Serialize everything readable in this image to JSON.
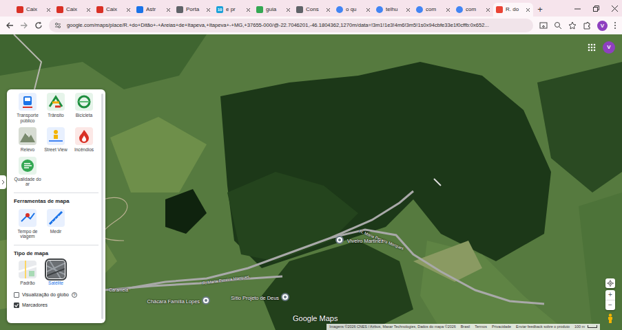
{
  "tabs": [
    {
      "label": "Caix",
      "selected": false
    },
    {
      "label": "Caix",
      "selected": false
    },
    {
      "label": "Caix",
      "selected": false
    },
    {
      "label": "Astr",
      "selected": false
    },
    {
      "label": "Porta",
      "selected": false
    },
    {
      "label": "e pr",
      "selected": false,
      "icon_text": "10"
    },
    {
      "label": "guia",
      "selected": false
    },
    {
      "label": "Cons",
      "selected": false
    },
    {
      "label": "o qu",
      "selected": false
    },
    {
      "label": "telhu",
      "selected": false
    },
    {
      "label": "com",
      "selected": false
    },
    {
      "label": "com",
      "selected": false
    },
    {
      "label": "R. do",
      "selected": true
    }
  ],
  "new_tab": "+",
  "address_bar": {
    "url": "google.com/maps/place/R.+do+Ditão+-+Areias+de+Itapeva,+Itapeva+-+MG,+37655-000/@-22.7046201,-46.1804362,1270m/data=!3m1!1e3!4m6!3m5!1s0x94cbfe33e1f0cffb:0x652..."
  },
  "profile": {
    "initial": "V"
  },
  "map": {
    "road_labels": [
      "R. Maria Pereira Marques",
      "R. Maria Pereira Marques"
    ],
    "places": [
      {
        "name": "Viveiro Martinez"
      },
      {
        "name": "Chácara Família Lopes"
      },
      {
        "name": "Sítio Projeto de Deus"
      }
    ],
    "area_labels": [
      "Caramela"
    ],
    "watermark": "Google Maps",
    "account": {
      "initial": "V"
    },
    "zoom_in": "+",
    "zoom_out": "−"
  },
  "layers_panel": {
    "layers": [
      {
        "label": "Transporte público"
      },
      {
        "label": "Trânsito"
      },
      {
        "label": "Bicicleta"
      },
      {
        "label": "Relevo"
      },
      {
        "label": "Street View"
      },
      {
        "label": "Incêndios"
      },
      {
        "label": "Qualidade do ar"
      }
    ],
    "tools_heading": "Ferramentas de mapa",
    "tools": [
      {
        "label": "Tempo de viagem"
      },
      {
        "label": "Medir"
      }
    ],
    "type_heading": "Tipo de mapa",
    "types": [
      {
        "label": "Padrão",
        "selected": false
      },
      {
        "label": "Satélite",
        "selected": true
      }
    ],
    "options": [
      {
        "label": "Visualização do globo",
        "checked": false,
        "help": "?"
      },
      {
        "label": "Marcadores",
        "checked": true
      }
    ]
  },
  "footer": {
    "attribution": "Imagens ©2026 CNES / Airbus, Maxar Technologies, Dados do mapa ©2026",
    "links": [
      "Brasil",
      "Termos",
      "Privacidade",
      "Enviar feedback sobre o produto"
    ],
    "scale": "100 m"
  }
}
